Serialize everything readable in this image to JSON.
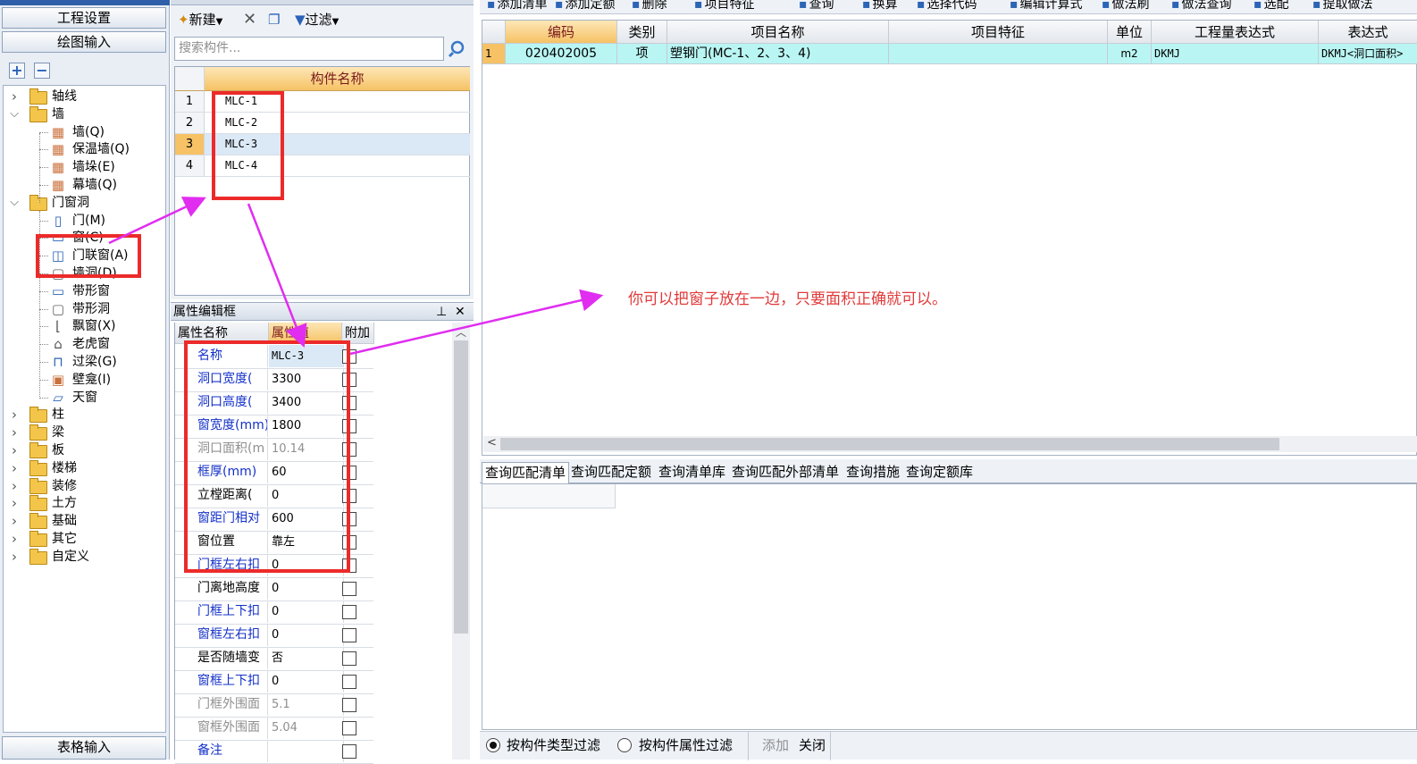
{
  "left_nav": {
    "btn_project_settings": "工程设置",
    "btn_drawing_input": "绘图输入",
    "btn_table_input": "表格输入",
    "btn_expand": "+",
    "btn_collapse": "−",
    "tree": [
      {
        "label": "轴线",
        "level": 0,
        "type": "folder",
        "expanded": false
      },
      {
        "label": "墙",
        "level": 0,
        "type": "folder",
        "expanded": true
      },
      {
        "label": "墙(Q)",
        "level": 1,
        "type": "wall-icon"
      },
      {
        "label": "保温墙(Q)",
        "level": 1,
        "type": "wall-icon"
      },
      {
        "label": "墙垛(E)",
        "level": 1,
        "type": "wall-icon"
      },
      {
        "label": "幕墙(Q)",
        "level": 1,
        "type": "wall-icon"
      },
      {
        "label": "门窗洞",
        "level": 0,
        "type": "folder",
        "expanded": true
      },
      {
        "label": "门(M)",
        "level": 1,
        "type": "door-icon"
      },
      {
        "label": "窗(C)",
        "level": 1,
        "type": "window-icon"
      },
      {
        "label": "门联窗(A)",
        "level": 1,
        "type": "door-window-icon"
      },
      {
        "label": "墙洞(D)",
        "level": 1,
        "type": "opening-icon"
      },
      {
        "label": "带形窗",
        "level": 1,
        "type": "window-icon"
      },
      {
        "label": "带形洞",
        "level": 1,
        "type": "opening-icon"
      },
      {
        "label": "飘窗(X)",
        "level": 1,
        "type": "bay-window-icon"
      },
      {
        "label": "老虎窗",
        "level": 1,
        "type": "dormer-icon"
      },
      {
        "label": "过梁(G)",
        "level": 1,
        "type": "lintel-icon"
      },
      {
        "label": "壁龛(I)",
        "level": 1,
        "type": "niche-icon"
      },
      {
        "label": "天窗",
        "level": 1,
        "type": "skylight-icon"
      },
      {
        "label": "柱",
        "level": 0,
        "type": "folder",
        "expanded": false
      },
      {
        "label": "梁",
        "level": 0,
        "type": "folder",
        "expanded": false
      },
      {
        "label": "板",
        "level": 0,
        "type": "folder",
        "expanded": false
      },
      {
        "label": "楼梯",
        "level": 0,
        "type": "folder",
        "expanded": false
      },
      {
        "label": "装修",
        "level": 0,
        "type": "folder",
        "expanded": false
      },
      {
        "label": "土方",
        "level": 0,
        "type": "folder",
        "expanded": false
      },
      {
        "label": "基础",
        "level": 0,
        "type": "folder",
        "expanded": false
      },
      {
        "label": "其它",
        "level": 0,
        "type": "folder",
        "expanded": false
      },
      {
        "label": "自定义",
        "level": 0,
        "type": "folder",
        "expanded": false
      }
    ]
  },
  "component_panel": {
    "btn_new": "新建",
    "btn_filter": "过滤",
    "search_placeholder": "搜索构件...",
    "column_name": "构件名称",
    "rows": [
      {
        "num": "1",
        "name": "MLC-1"
      },
      {
        "num": "2",
        "name": "MLC-2"
      },
      {
        "num": "3",
        "name": "MLC-3"
      },
      {
        "num": "4",
        "name": "MLC-4"
      }
    ],
    "selected_row": 3
  },
  "property_panel": {
    "title": "属性编辑框",
    "pin_icon": "pin-icon",
    "close_icon": "close-icon",
    "col_name": "属性名称",
    "col_value": "属性值",
    "col_extra": "附加",
    "rows": [
      {
        "name": "名称",
        "value": "MLC-3",
        "color": "blue"
      },
      {
        "name": "洞口宽度(",
        "value": "3300",
        "color": "blue"
      },
      {
        "name": "洞口高度(",
        "value": "3400",
        "color": "blue"
      },
      {
        "name": "窗宽度(mm)",
        "value": "1800",
        "color": "blue"
      },
      {
        "name": "洞口面积(m",
        "value": "10.14",
        "color": "gray"
      },
      {
        "name": "框厚(mm)",
        "value": "60",
        "color": "blue"
      },
      {
        "name": "立樘距离(",
        "value": "0",
        "color": "black"
      },
      {
        "name": "窗距门相对",
        "value": "600",
        "color": "blue"
      },
      {
        "name": "窗位置",
        "value": "靠左",
        "color": "black"
      },
      {
        "name": "门框左右扣",
        "value": "0",
        "color": "blue"
      },
      {
        "name": "门离地高度",
        "value": "0",
        "color": "black"
      },
      {
        "name": "门框上下扣",
        "value": "0",
        "color": "blue"
      },
      {
        "name": "窗框左右扣",
        "value": "0",
        "color": "blue"
      },
      {
        "name": "是否随墙变",
        "value": "否",
        "color": "black"
      },
      {
        "name": "窗框上下扣",
        "value": "0",
        "color": "blue"
      },
      {
        "name": "门框外围面",
        "value": "5.1",
        "color": "gray"
      },
      {
        "name": "窗框外围面",
        "value": "5.04",
        "color": "gray"
      },
      {
        "name": "备注",
        "value": "",
        "color": "blue"
      }
    ]
  },
  "right_toolbar": {
    "items": [
      "添加清单",
      "添加定额",
      "删除",
      "项目特征",
      "查询",
      "换算",
      "选择代码",
      "编辑计算式",
      "做法刷",
      "做法查询",
      "选配",
      "提取做法"
    ]
  },
  "main_grid": {
    "headers": [
      "编码",
      "类别",
      "项目名称",
      "项目特征",
      "单位",
      "工程量表达式",
      "表达式"
    ],
    "rows": [
      {
        "num": "1",
        "code": "020402005",
        "category": "项",
        "name": "塑钢门(MC-1、2、3、4)",
        "feature": "",
        "unit": "m2",
        "expr": "DKMJ",
        "expr_desc": "DKMJ<洞口面积>"
      }
    ]
  },
  "query_tabs": {
    "tabs": [
      "查询匹配清单",
      "查询匹配定额",
      "查询清单库",
      "查询匹配外部清单",
      "查询措施",
      "查询定额库"
    ],
    "active": 0
  },
  "query_bottom": {
    "radio_type": "按构件类型过滤",
    "radio_attr": "按构件属性过滤",
    "btn_add": "添加",
    "btn_close": "关闭"
  },
  "annotation": {
    "note": "你可以把窗子放在一边，只要面积正确就可以。",
    "color": "#e13a3a"
  }
}
